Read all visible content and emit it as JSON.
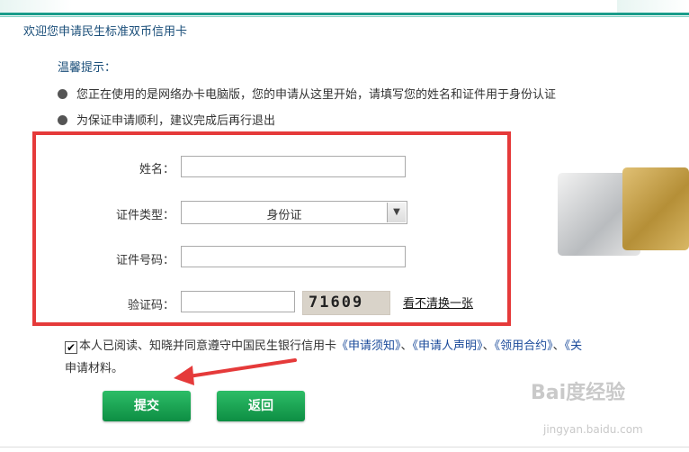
{
  "header": {
    "welcome": "欢迎您申请民生标准双币信用卡"
  },
  "tips": {
    "title": "温馨提示：",
    "items": [
      "您正在使用的是网络办卡电脑版，您的申请从这里开始，请填写您的姓名和证件用于身份认证",
      "为保证申请顺利，建议完成后再行退出"
    ]
  },
  "form": {
    "name_label": "姓名：",
    "name_value": "",
    "id_type_label": "证件类型：",
    "id_type_value": "身份证",
    "id_number_label": "证件号码：",
    "id_number_value": "",
    "captcha_label": "验证码：",
    "captcha_value": "",
    "captcha_text": "71609",
    "refresh_label": "看不清换一张"
  },
  "agreement": {
    "checked": true,
    "text_prefix": "本人已阅读、知晓并同意遵守中国民生银行信用卡",
    "link1": "《申请须知》",
    "sep1": "、",
    "link2": "《申请人声明》",
    "sep2": "、",
    "link3": "《领用合约》",
    "sep3": "、",
    "link4": "《关",
    "line2": "申请材料。"
  },
  "buttons": {
    "submit": "提交",
    "back": "返回"
  },
  "watermark": {
    "brand": "Bai度经验",
    "url": "jingyan.baidu.com"
  },
  "colors": {
    "accent": "#1a9c8a",
    "highlight_box": "#e53a3a",
    "button": "#0d8e43"
  }
}
